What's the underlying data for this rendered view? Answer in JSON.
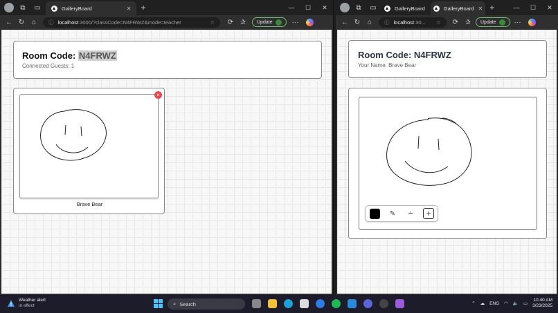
{
  "colors": {
    "accent_green": "#6dbb6d",
    "close_badge": "#e5484d",
    "pen_color": "#000000"
  },
  "left_window": {
    "tab_title": "GalleryBoard",
    "url_host": "localhost",
    "url_rest": ":3000/?classCode=N4FRWZ&mode=teacher",
    "update_label": "Update",
    "room": {
      "label": "Room Code: ",
      "code": "N4FRWZ",
      "subtitle": "Connected Guests: 1"
    },
    "guest": {
      "name": "Brave Bear",
      "close": "×"
    }
  },
  "right_window": {
    "tab1_title": "GalleryBoard",
    "tab2_title": "GalleryBoard",
    "url_host": "localhost",
    "url_rest": ":30...",
    "update_label": "Update",
    "room": {
      "label": "Room Code: ",
      "code": "N4FRWZ",
      "subtitle": "Your Name: Brave Bear"
    },
    "tools": {
      "plus": "+"
    }
  },
  "taskbar": {
    "weather_title": "Weather alert",
    "weather_sub": "in effect",
    "search_placeholder": "Search",
    "lang": "ENG",
    "time": "10:40 AM",
    "date": "3/23/2025"
  }
}
